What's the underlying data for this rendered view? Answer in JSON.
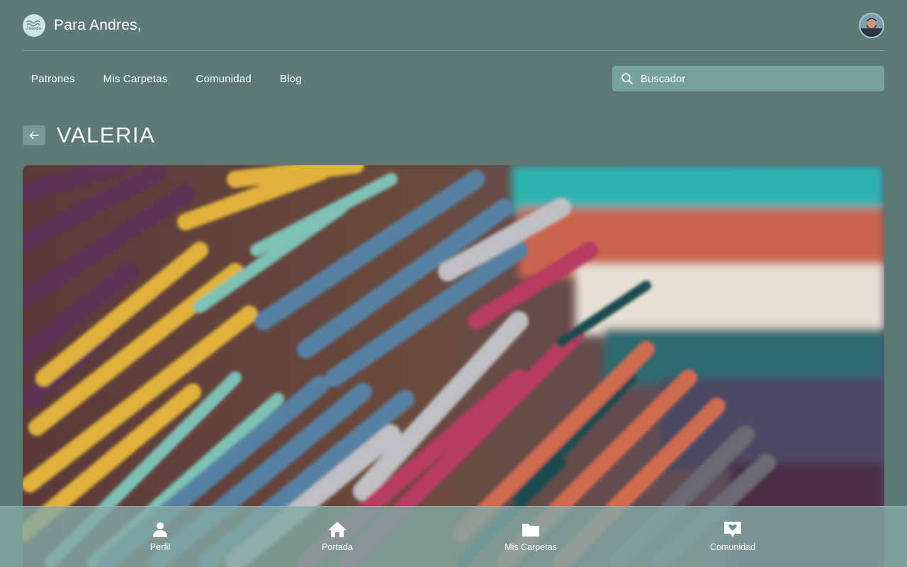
{
  "header": {
    "greeting": "Para Andres,",
    "logo_text": "celeste"
  },
  "nav": {
    "items": [
      {
        "label": "Patrones"
      },
      {
        "label": "Mis Carpetas"
      },
      {
        "label": "Comunidad"
      },
      {
        "label": "Blog"
      }
    ]
  },
  "search": {
    "placeholder": "Buscador",
    "icon": "search-icon"
  },
  "page": {
    "title": "VALERIA",
    "back_icon": "arrow-left-icon",
    "hero_image": "crochet-colorful-yarn-photo"
  },
  "bottom_nav": {
    "items": [
      {
        "label": "Perfil",
        "icon": "person-icon"
      },
      {
        "label": "Portada",
        "icon": "home-icon"
      },
      {
        "label": "Mis Carpetas",
        "icon": "folder-icon"
      },
      {
        "label": "Comunidad",
        "icon": "chat-heart-icon"
      }
    ]
  },
  "colors": {
    "background": "#5e7a76",
    "search_bg": "#78a29c",
    "bottom_nav_bg": "#84a8a3",
    "text": "#ffffff"
  }
}
